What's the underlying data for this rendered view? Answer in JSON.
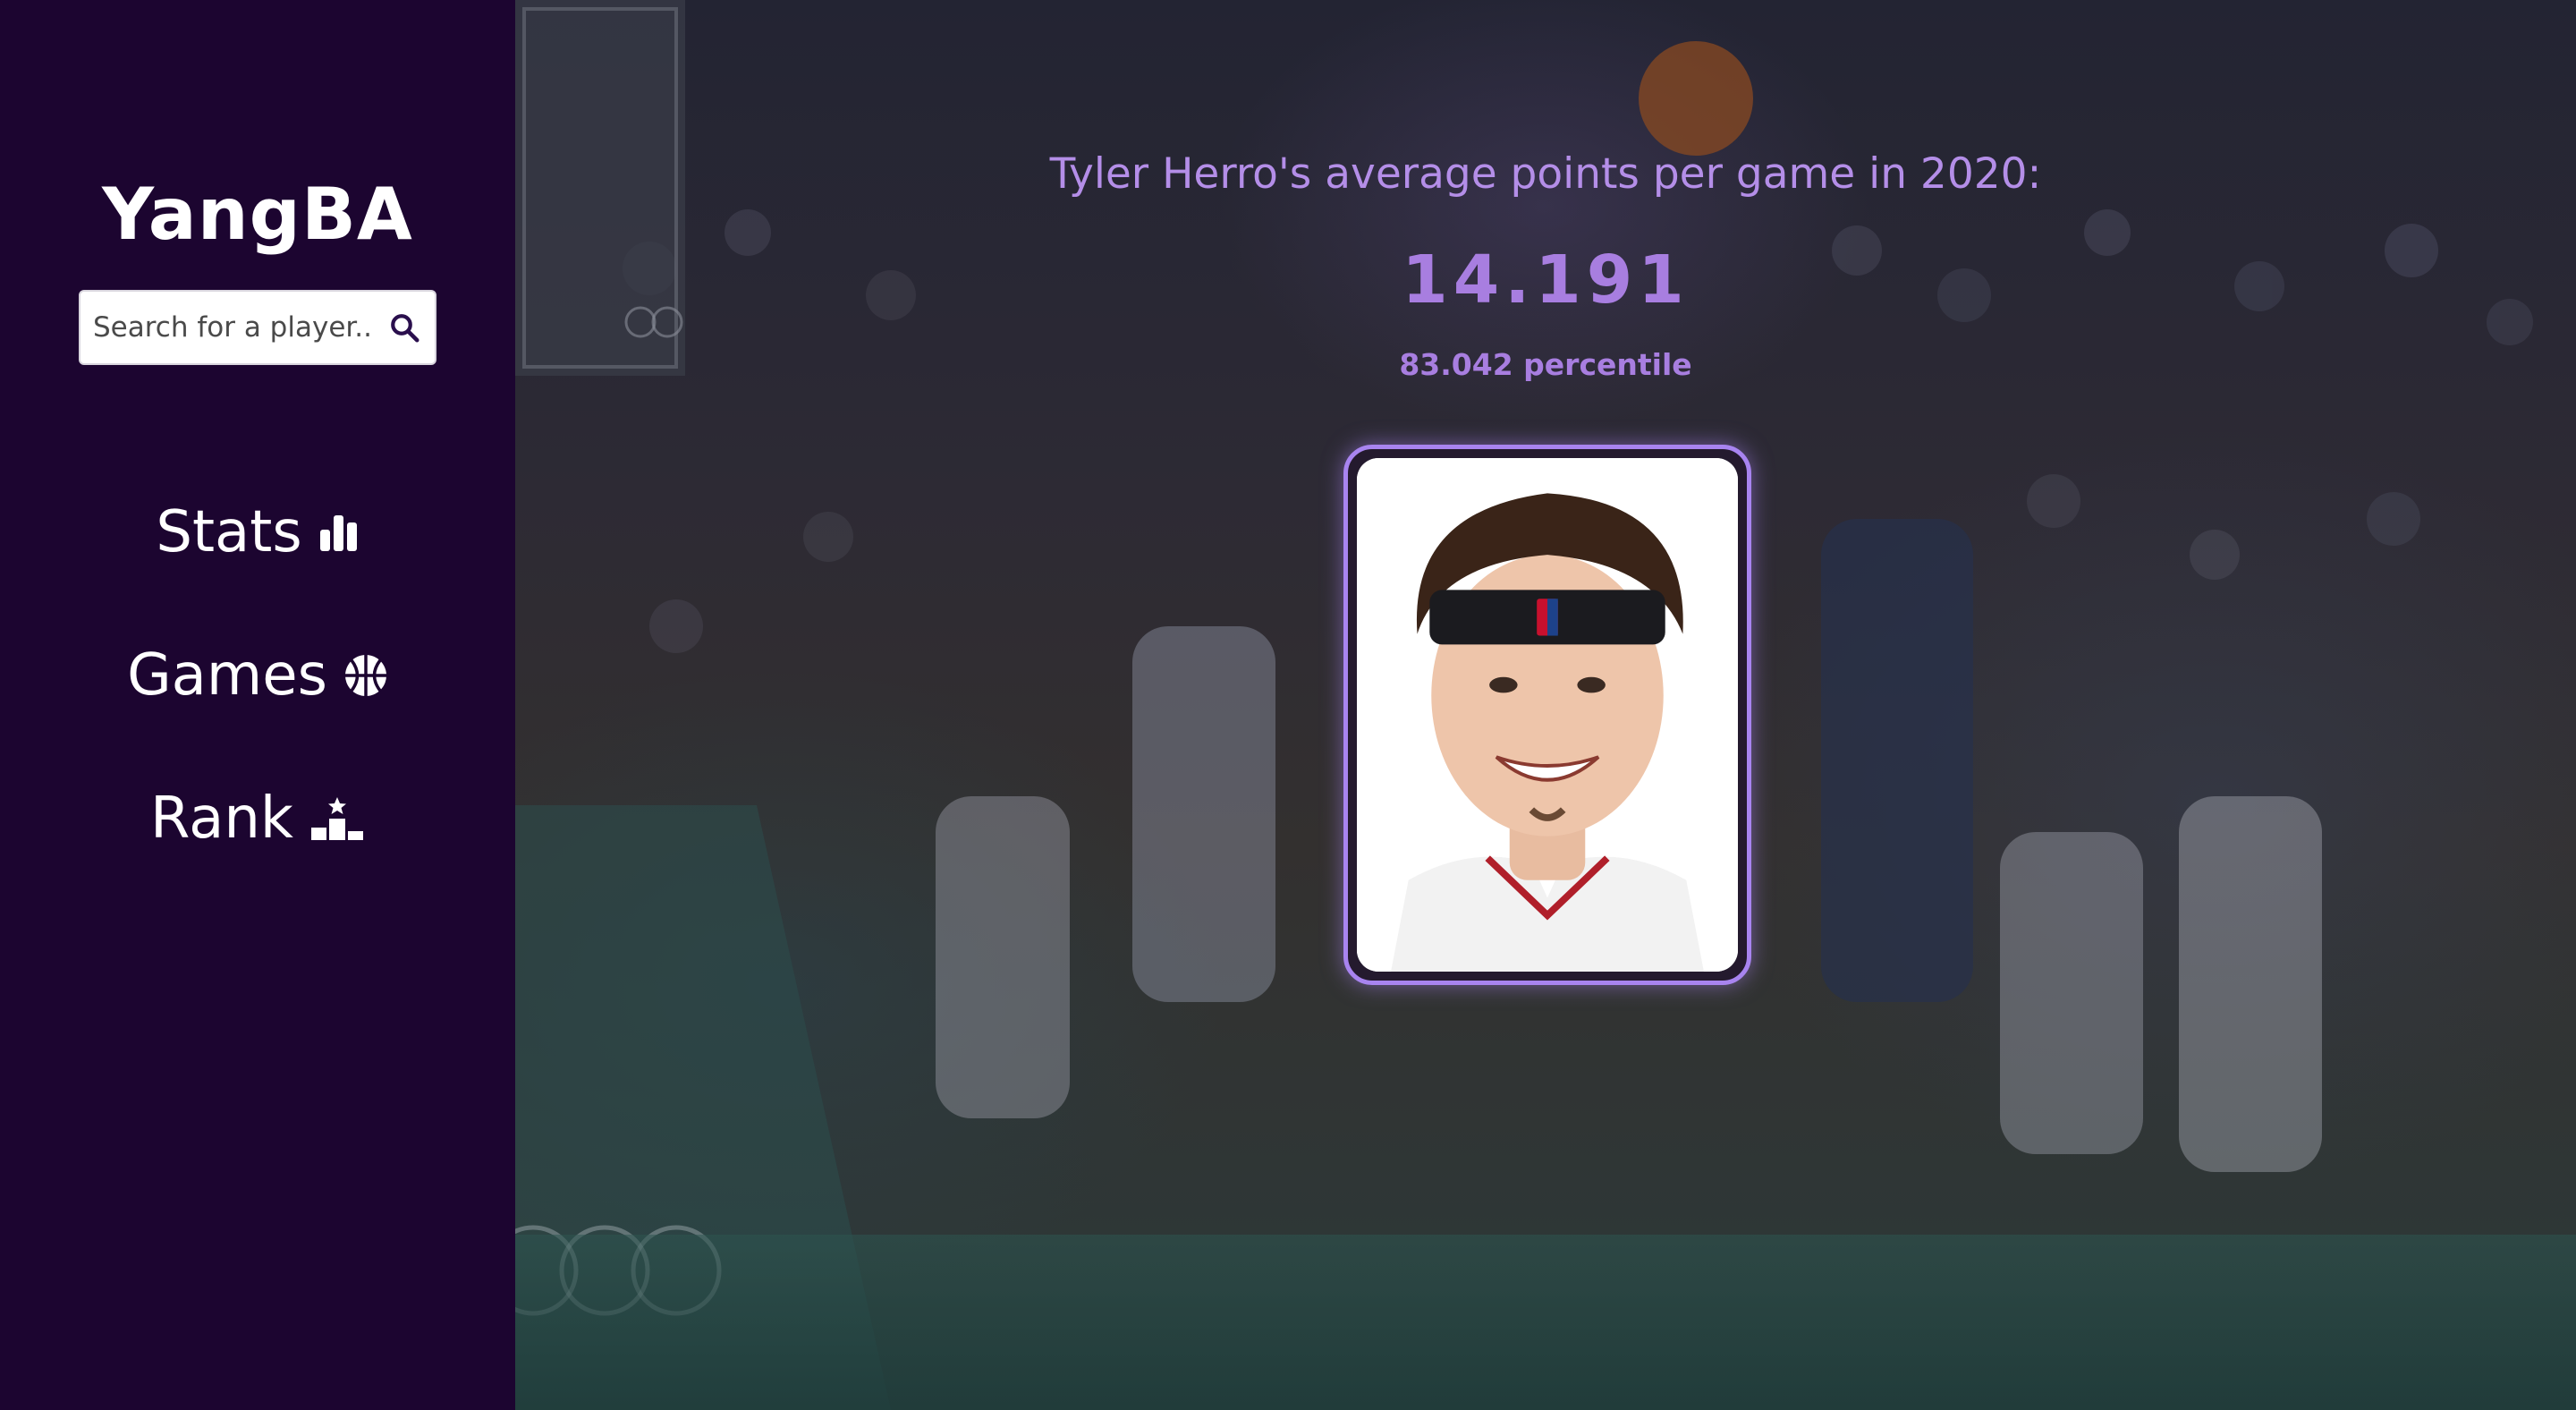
{
  "app": {
    "title": "YangBA"
  },
  "search": {
    "placeholder": "Search for a player...",
    "icon": "search-icon"
  },
  "nav": {
    "items": [
      {
        "label": "Stats",
        "icon": "bar-chart-icon"
      },
      {
        "label": "Games",
        "icon": "basketball-icon"
      },
      {
        "label": "Rank",
        "icon": "podium-icon"
      }
    ]
  },
  "stat": {
    "headline": "Tyler Herro's average points per game in 2020:",
    "value": "14.191",
    "percentile": "83.042 percentile"
  },
  "colors": {
    "sidebar": "#1c0530",
    "accent": "#b48ee8",
    "card_border": "#a884f0"
  }
}
